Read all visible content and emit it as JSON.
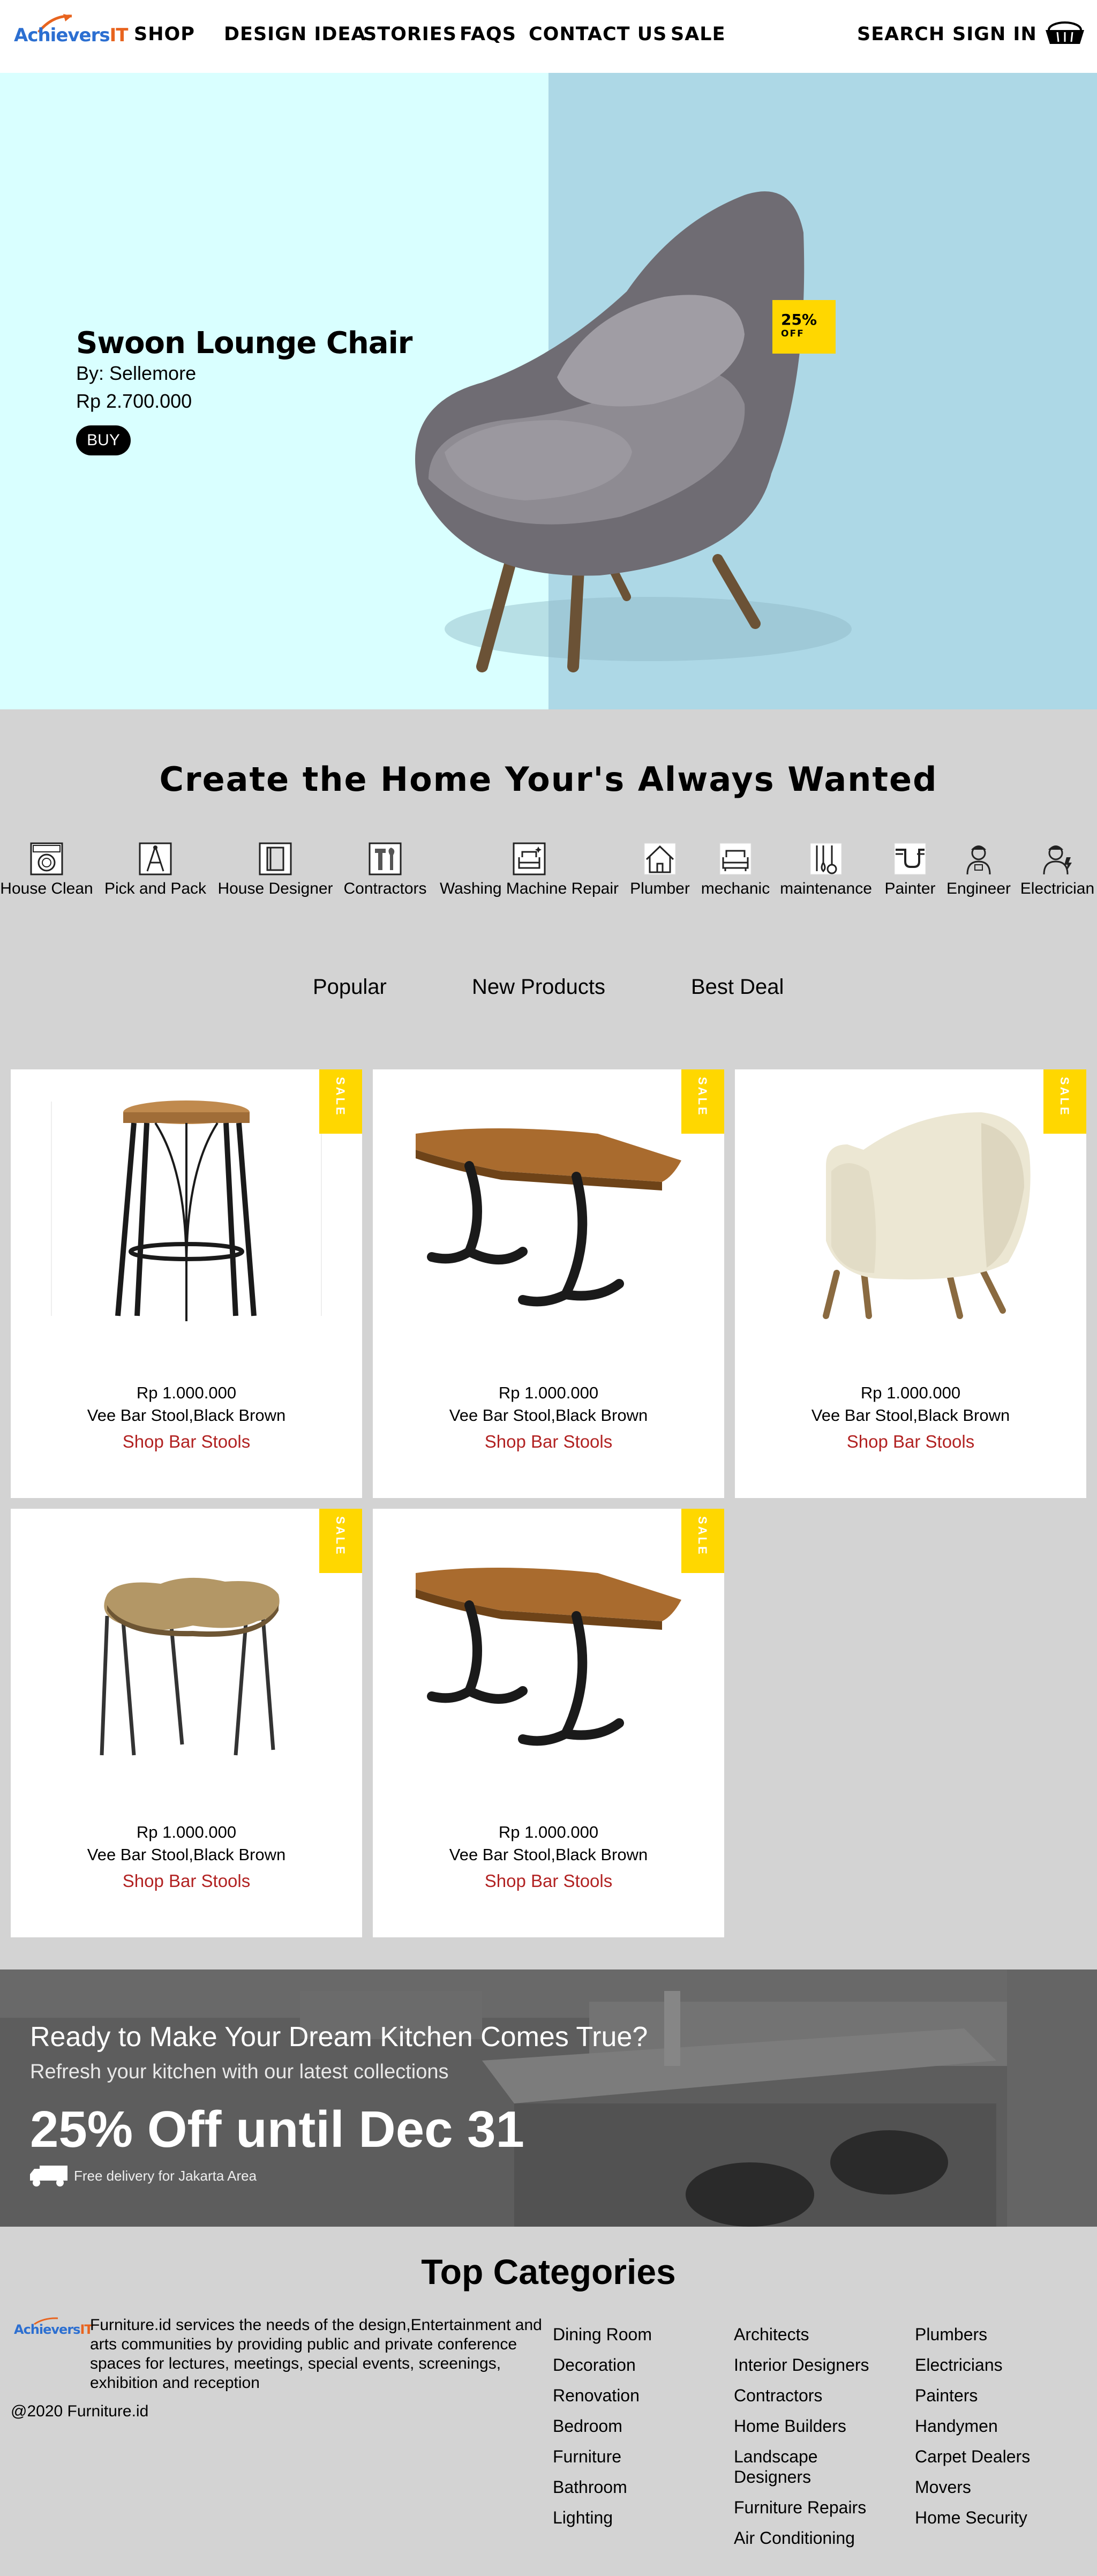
{
  "nav": {
    "logo_text_a": "Achie",
    "logo_text_b": "vers",
    "logo_text_c": "IT",
    "items": [
      "SHOP",
      "DESIGN IDEA",
      "STORIES",
      "FAQS",
      "CONTACT US",
      "SALE"
    ],
    "search": "SEARCH",
    "signin": "SIGN IN",
    "cart_icon": "basket-icon"
  },
  "hero": {
    "title": "Swoon Lounge Chair",
    "by": "By: Sellemore",
    "price": "Rp 2.700.000",
    "buy": "BUY",
    "badge_percent": "25%",
    "badge_off": "OFF",
    "left_color": "#d9ffff",
    "right_color": "#add8e6"
  },
  "services": {
    "title": "Create the Home Your's Always Wanted",
    "items": [
      "House Clean",
      "Pick and Pack",
      "House Designer",
      "Contractors",
      "Washing Machine Repair",
      "Plumber",
      "mechanic",
      "maintenance",
      "Painter",
      "Engineer",
      "Electrician"
    ]
  },
  "tabs": [
    "Popular",
    "New Products",
    "Best Deal"
  ],
  "products": [
    {
      "image": "bar-stool",
      "sale": "SALE",
      "price": "Rp 1.000.000",
      "name": "Vee Bar Stool,Black Brown",
      "link": "Shop Bar Stools"
    },
    {
      "image": "wood-table",
      "sale": "SALE",
      "price": "Rp 1.000.000",
      "name": "Vee Bar Stool,Black Brown",
      "link": "Shop Bar Stools"
    },
    {
      "image": "cream-armchair",
      "sale": "SALE",
      "price": "Rp 1.000.000",
      "name": "Vee Bar Stool,Black Brown",
      "link": "Shop Bar Stools"
    },
    {
      "image": "live-edge-side-table",
      "sale": "SALE",
      "price": "Rp 1.000.000",
      "name": "Vee Bar Stool,Black Brown",
      "link": "Shop Bar Stools"
    },
    {
      "image": "wood-table",
      "sale": "SALE",
      "price": "Rp 1.000.000",
      "name": "Vee Bar Stool,Black Brown",
      "link": "Shop Bar Stools"
    }
  ],
  "banner": {
    "headline": "Ready to Make Your Dream Kitchen Comes True?",
    "sub": "Refresh your kitchen with our latest collections",
    "offer": "25% Off until Dec 31",
    "delivery": "Free delivery for Jakarta Area"
  },
  "footer": {
    "title": "Top Categories",
    "description": "Furniture.id services the needs of the design,Entertainment and arts communities by providing public and private conference spaces for lectures, meetings, special events, screenings, exhibition and reception",
    "copyright": "@2020 Furniture.id",
    "col1": [
      "Dining Room",
      "Decoration",
      "Renovation",
      "Bedroom",
      "Furniture",
      "Bathroom",
      "Lighting"
    ],
    "col2": [
      "Architects",
      "Interior Designers",
      "Contractors",
      "Home Builders",
      "Landscape Designers",
      "Furniture Repairs",
      "Air Conditioning"
    ],
    "col3": [
      "Plumbers",
      "Electricians",
      "Painters",
      "Handymen",
      "Carpet Dealers",
      "Movers",
      "Home Security"
    ]
  },
  "colors": {
    "accent_yellow": "#ffd700",
    "link_red": "#b22222",
    "page_gray": "#d3d3d3"
  }
}
